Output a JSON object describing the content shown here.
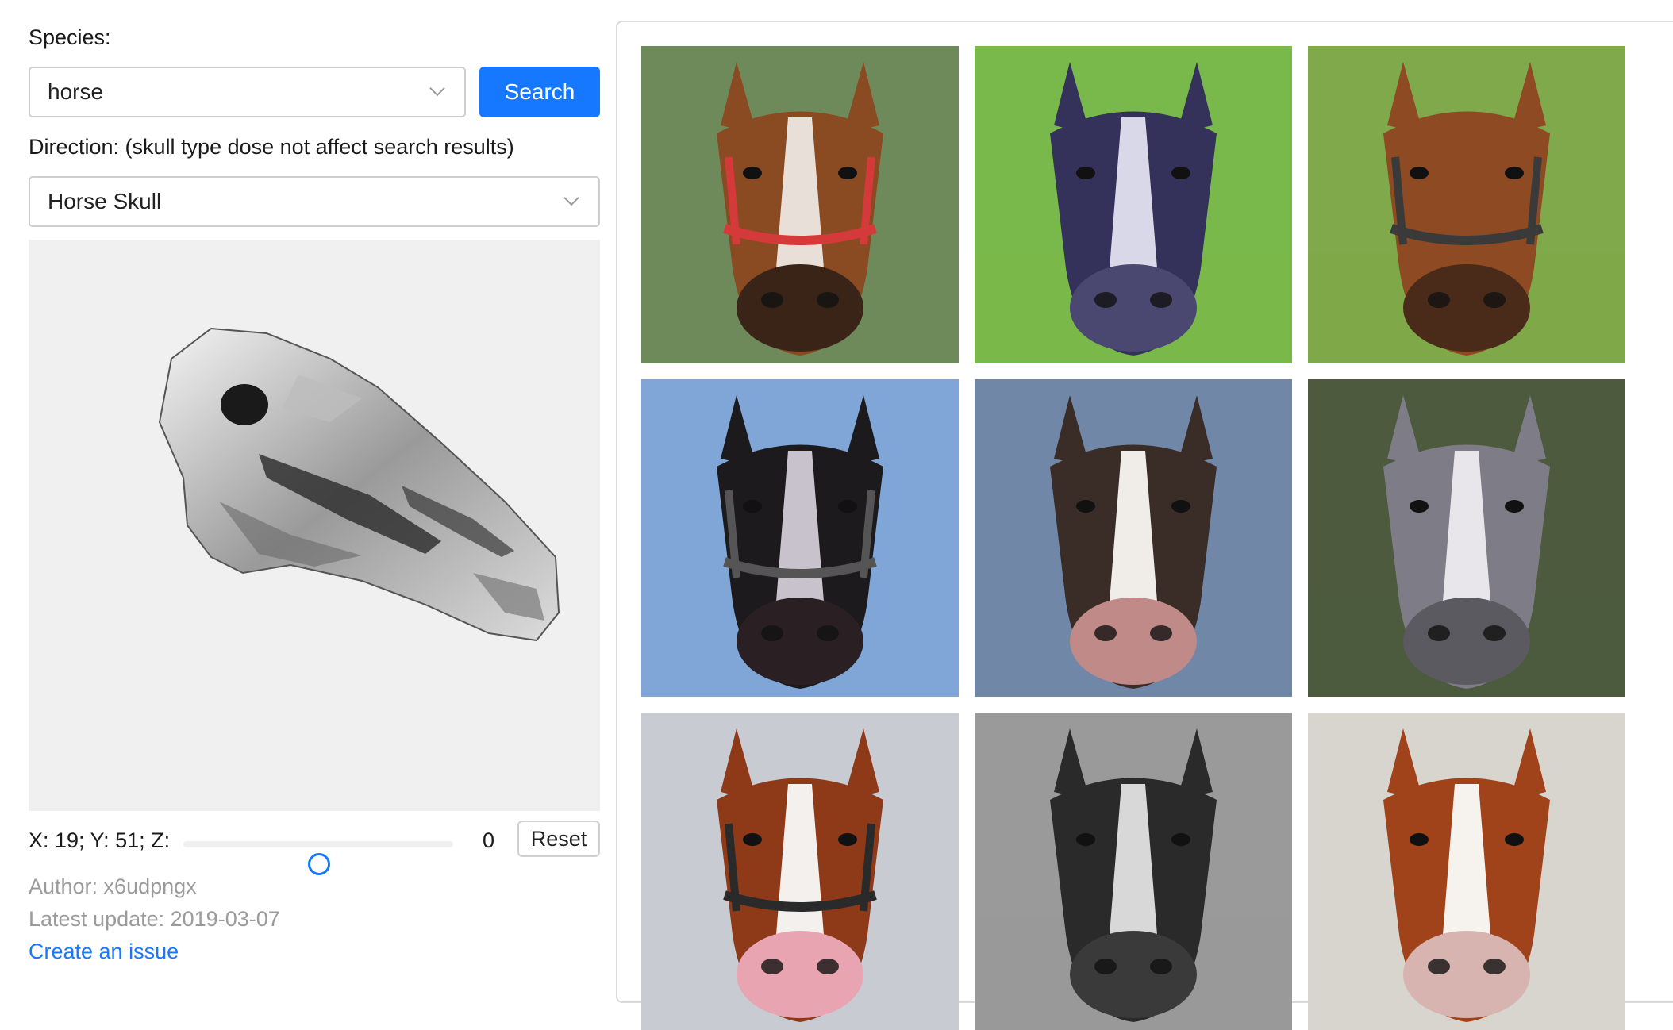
{
  "species": {
    "label": "Species:",
    "value": "horse"
  },
  "search": {
    "label": "Search"
  },
  "direction": {
    "label": "Direction: (skull type dose not affect search results)",
    "value": "Horse Skull"
  },
  "coords": {
    "label": "X: 19; Y: 51; Z:",
    "z_value": "0",
    "slider_fraction": 0.5
  },
  "reset": {
    "label": "Reset"
  },
  "author": "Author: x6udpngx",
  "latest_update": "Latest update: 2019-03-07",
  "issue_link": "Create an issue",
  "colors": {
    "accent": "#1677ff",
    "meta_text": "#9b9b9b",
    "viewer_bg": "#f0f0f0"
  },
  "results": [
    {
      "name": "horse-photo-1",
      "bg": "#6f8a5a",
      "coat": "#8a4a22",
      "blaze": "#e8e0d8",
      "nose": "#3a2418",
      "halter": "#d43a3a"
    },
    {
      "name": "horse-photo-2",
      "bg": "#79b84a",
      "coat": "#34325a",
      "blaze": "#d8d8e8",
      "nose": "#4a4870",
      "halter": ""
    },
    {
      "name": "horse-photo-3",
      "bg": "#7fa94a",
      "coat": "#8e4a22",
      "blaze": "",
      "nose": "#4a2a18",
      "halter": "#3a3a3a"
    },
    {
      "name": "horse-photo-4",
      "bg": "#7fa6d6",
      "coat": "#1c1a1c",
      "blaze": "#c8c2cc",
      "nose": "#2a2024",
      "halter": "#555"
    },
    {
      "name": "horse-photo-5",
      "bg": "#7087a8",
      "coat": "#3a2c26",
      "blaze": "#f0ece8",
      "nose": "#c08a88",
      "halter": ""
    },
    {
      "name": "horse-photo-6",
      "bg": "#4d5a3e",
      "coat": "#7e7c86",
      "blaze": "#e8e6ea",
      "nose": "#5a5a60",
      "halter": ""
    },
    {
      "name": "horse-photo-7",
      "bg": "#c8ccd2",
      "coat": "#8e3a18",
      "blaze": "#f4f0ee",
      "nose": "#e8a4b0",
      "halter": "#2a2a2a"
    },
    {
      "name": "horse-photo-8",
      "bg": "#9a9a9a",
      "coat": "#2a2a2a",
      "blaze": "#d8d8d8",
      "nose": "#3a3a3a",
      "halter": ""
    },
    {
      "name": "horse-photo-9",
      "bg": "#d8d4ce",
      "coat": "#a0421a",
      "blaze": "#f6f2ee",
      "nose": "#d8b4b0",
      "halter": ""
    }
  ]
}
